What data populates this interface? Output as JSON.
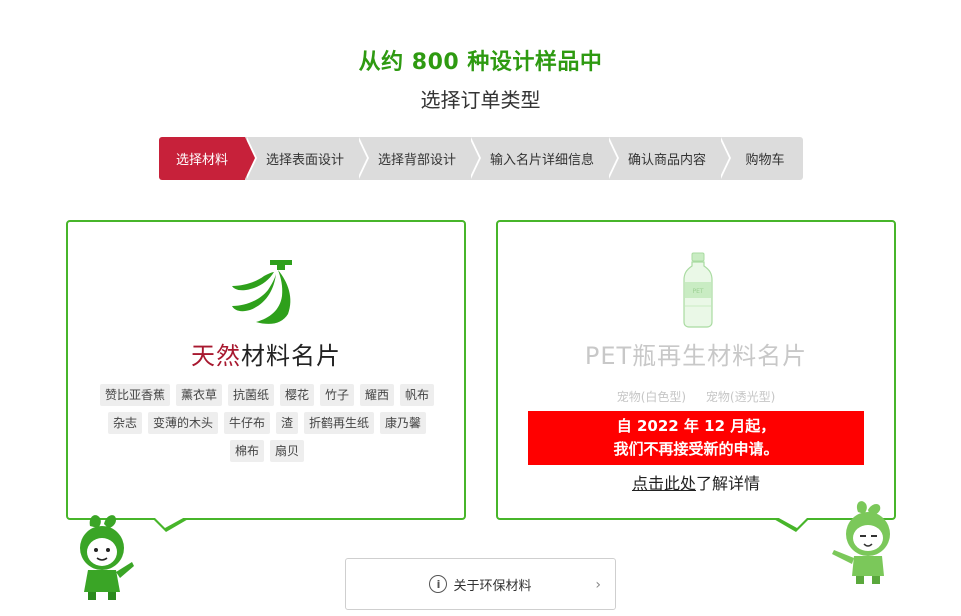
{
  "hero": {
    "title": "从约 800 种设计样品中",
    "subtitle": "选择订单类型"
  },
  "steps": [
    {
      "label": "选择材料",
      "active": true
    },
    {
      "label": "选择表面设计",
      "active": false
    },
    {
      "label": "选择背部设计",
      "active": false
    },
    {
      "label": "输入名片详细信息",
      "active": false
    },
    {
      "label": "确认商品内容",
      "active": false
    },
    {
      "label": "购物车",
      "active": false
    }
  ],
  "natural_card": {
    "title_accent": "天然",
    "title_rest": "材料名片",
    "icon": "banana-icon",
    "tags": [
      "赞比亚香蕉",
      "薰衣草",
      "抗菌纸",
      "樱花",
      "竹子",
      "耀西",
      "帆布",
      "杂志",
      "变薄的木头",
      "牛仔布",
      "渣",
      "折鹤再生纸",
      "康乃馨",
      "棉布",
      "扇贝"
    ]
  },
  "pet_card": {
    "title": "PET瓶再生材料名片",
    "icon": "pet-bottle-icon",
    "variants": [
      "宠物(白色型)",
      "宠物(透光型)"
    ],
    "notice_line1": "自 2022 年 12 月起，",
    "notice_line2": "我们不再接受新的申请。",
    "detail_link": "点击此处",
    "detail_rest": "了解详情"
  },
  "eco_button": {
    "label": "关于环保材料",
    "icon": "info-icon"
  },
  "colors": {
    "brand_green": "#2e9a11",
    "card_border": "#47b52a",
    "active_step": "#c7213a",
    "notice_red": "#ff0000",
    "accent_red": "#a8182f"
  }
}
